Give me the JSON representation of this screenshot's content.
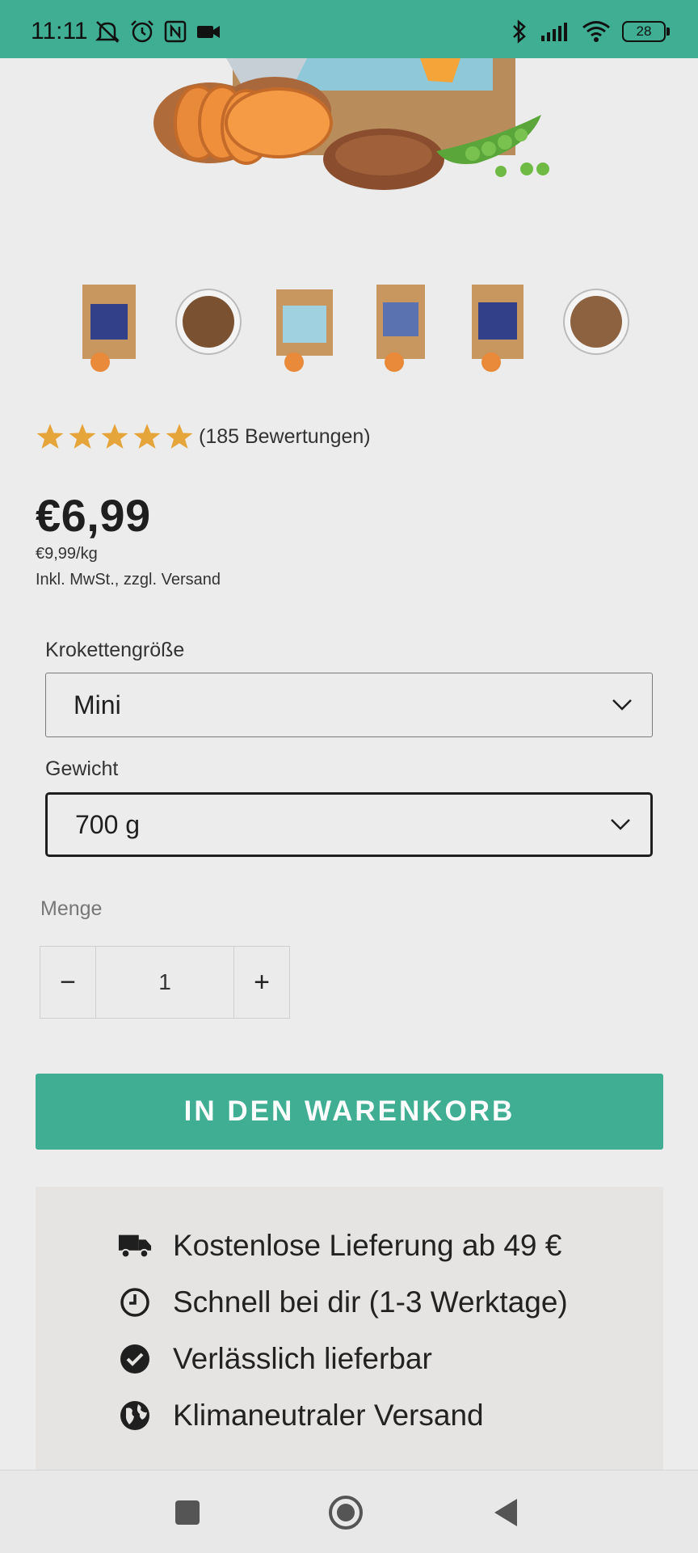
{
  "status_bar": {
    "time": "11:11",
    "battery": "28",
    "icons_left": [
      "mute-icon",
      "alarm-icon",
      "nfc-icon",
      "video-icon"
    ],
    "icons_right": [
      "bluetooth-icon",
      "signal-icon",
      "wifi-icon",
      "battery-icon"
    ]
  },
  "product": {
    "rating_stars": 5,
    "rating_text": "(185 Bewertungen)",
    "price": "€6,99",
    "unit_price": "€9,99/kg",
    "tax_note": "Inkl. MwSt., zzgl. Versand"
  },
  "options": {
    "size_label": "Krokettengröße",
    "size_value": "Mini",
    "weight_label": "Gewicht",
    "weight_value": "700 g",
    "quantity_label": "Menge",
    "quantity_value": "1",
    "minus": "−",
    "plus": "+"
  },
  "cart_button": "IN DEN WARENKORB",
  "benefits": [
    {
      "icon": "truck-icon",
      "text": "Kostenlose Lieferung ab 49 €"
    },
    {
      "icon": "clock-icon",
      "text": "Schnell bei dir (1-3 Werktage)"
    },
    {
      "icon": "check-circle-icon",
      "text": "Verlässlich lieferbar"
    },
    {
      "icon": "globe-icon",
      "text": "Klimaneutraler Versand"
    }
  ],
  "thumbnails": [
    "product-bag-thumb",
    "kibble-bowl-thumb",
    "product-bag-thumb",
    "product-bag-thumb",
    "product-bag-thumb",
    "kibble-bowl-thumb"
  ],
  "colors": {
    "accent": "#3fae93",
    "star": "#e5a53a",
    "background": "#edecec"
  }
}
